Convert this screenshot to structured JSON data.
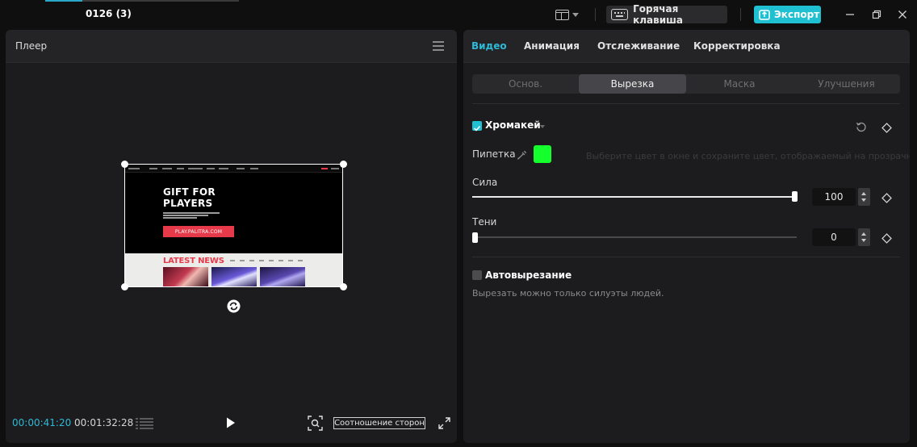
{
  "titlebar": {
    "project_title": "0126 (3)",
    "hotkey_label": "Горячая клавиша",
    "export_label": "Экспорт",
    "accent_color": "#1ec0d1",
    "progress": 0.19
  },
  "player": {
    "title": "Плеер",
    "preview": {
      "hero_title_line1": "GIFT FOR",
      "hero_title_line2": "PLAYERS",
      "cta_label": "PLAY.PALITRA.COM",
      "news_title": "LATEST NEWS"
    },
    "time_current": "00:00:41:20",
    "time_total": "00:01:32:28",
    "aspect_ratio_label": "Соотношение сторон"
  },
  "inspector": {
    "tabs": [
      {
        "label": "Видео",
        "active": true
      },
      {
        "label": "Анимация",
        "active": false
      },
      {
        "label": "Отслеживание",
        "active": false
      },
      {
        "label": "Корректировка",
        "active": false
      }
    ],
    "subtabs": [
      {
        "label": "Основ.",
        "active": false
      },
      {
        "label": "Вырезка",
        "active": true
      },
      {
        "label": "Маска",
        "active": false
      },
      {
        "label": "Улучшения",
        "active": false
      }
    ],
    "chroma": {
      "label": "Хромакей",
      "checked": true,
      "picker_label": "Пипетка",
      "picker_color": "#14ff2b",
      "picker_hint": "Выберите цвет в окне и сохраните цвет, отображаемый на прозрачность",
      "strength_label": "Сила",
      "strength_value": "100",
      "strength_fraction": 1.0,
      "shadow_label": "Тени",
      "shadow_value": "0",
      "shadow_fraction": 0.0
    },
    "auto_cutout": {
      "label": "Автовырезание",
      "checked": false,
      "hint": "Вырезать можно только силуэты людей."
    }
  },
  "icons": {
    "layout": "layout-icon",
    "keyboard": "keyboard-icon",
    "export": "upload-icon",
    "minimize": "minimize-icon",
    "maximize": "maximize-icon",
    "close": "close-icon",
    "menu": "menu-icon",
    "rotate": "rotate-icon",
    "timeline": "timeline-icon",
    "play": "play-icon",
    "zoom_fit": "zoom-fit-icon",
    "fullscreen": "fullscreen-icon",
    "reset": "reset-icon",
    "keyframe": "keyframe-diamond-icon",
    "eyedropper": "eyedropper-icon"
  }
}
